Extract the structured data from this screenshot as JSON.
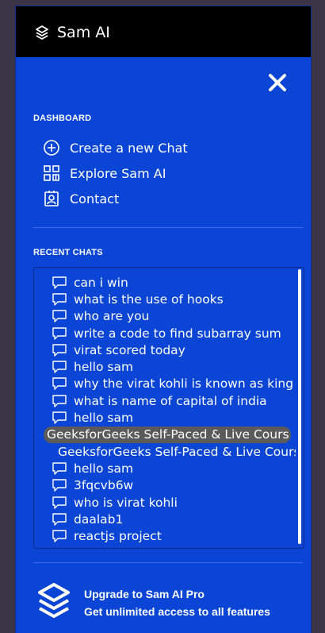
{
  "app": {
    "title": "Sam AI"
  },
  "sidebar": {
    "dashboard_label": "DASHBOARD",
    "nav": [
      {
        "label": "Create a new Chat",
        "icon": "plus-circle-icon"
      },
      {
        "label": "Explore Sam AI",
        "icon": "grid-icon"
      },
      {
        "label": "Contact",
        "icon": "contact-card-icon"
      }
    ],
    "recent_label": "RECENT CHATS",
    "chats": [
      "can i win",
      "what is the use of hooks",
      "who are you",
      "write a code to find subarray sum",
      "virat scored today",
      "hello sam",
      "why the virat kohli is known as king",
      "what is name of capital of india",
      "hello sam",
      "GeeksforGeeks Self-Paced & Live Cours",
      "GeeksforGeeks Self-Paced & Live Cours",
      "hello sam",
      "3fqcvb6w",
      "who is virat kohli",
      "daalab1",
      "reactjs project"
    ],
    "upgrade": {
      "title": "Upgrade to Sam AI Pro",
      "subtitle": "Get unlimited access to all features"
    }
  },
  "colors": {
    "panel": "#0a45d6",
    "topbar": "#000000",
    "highlight": "#5a5a5a"
  }
}
